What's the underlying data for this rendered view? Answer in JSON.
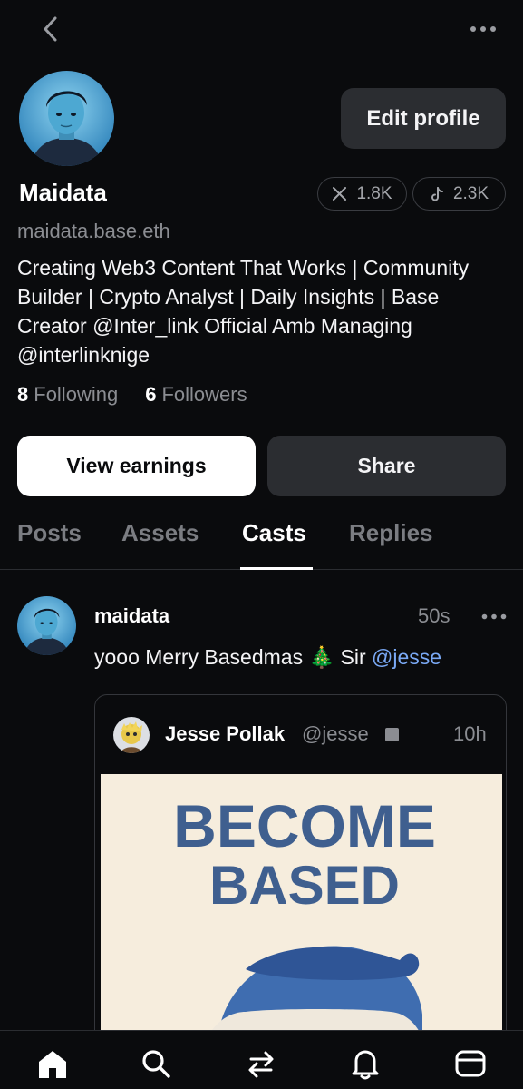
{
  "profile": {
    "display_name": "Maidata",
    "handle": "maidata.base.eth",
    "bio": "Creating Web3 Content That Works | Community Builder | Crypto Analyst | Daily Insights | Base Creator @Inter_link Official Amb Managing @interlinknige",
    "edit_label": "Edit profile",
    "socials": [
      {
        "platform": "x",
        "icon": "x-icon",
        "count": "1.8K"
      },
      {
        "platform": "tiktok",
        "icon": "tiktok-icon",
        "count": "2.3K"
      }
    ],
    "following_count": "8",
    "following_label": "Following",
    "followers_count": "6",
    "followers_label": "Followers"
  },
  "actions": {
    "earnings_label": "View earnings",
    "share_label": "Share"
  },
  "tabs": [
    {
      "label": "Posts",
      "active": false
    },
    {
      "label": "Assets",
      "active": false
    },
    {
      "label": "Casts",
      "active": true
    },
    {
      "label": "Replies",
      "active": false
    }
  ],
  "post": {
    "username": "maidata",
    "time": "50s",
    "text_before": "yooo Merry Basedmas 🎄 Sir ",
    "mention": "@jesse",
    "quote": {
      "name": "Jesse Pollak",
      "handle": "@jesse",
      "time": "10h",
      "image_text_line1": "BECOME",
      "image_text_line2": "BASED"
    }
  },
  "nav": [
    {
      "icon": "home-icon",
      "active": true
    },
    {
      "icon": "search-icon",
      "active": false
    },
    {
      "icon": "swap-icon",
      "active": false
    },
    {
      "icon": "bell-icon",
      "active": false
    },
    {
      "icon": "wallet-icon",
      "active": false
    }
  ],
  "colors": {
    "background": "#0a0b0d",
    "surface": "#2b2d31",
    "muted_text": "#8b8d92",
    "mention": "#7aa9f5",
    "image_accent": "#3f5f8f"
  }
}
